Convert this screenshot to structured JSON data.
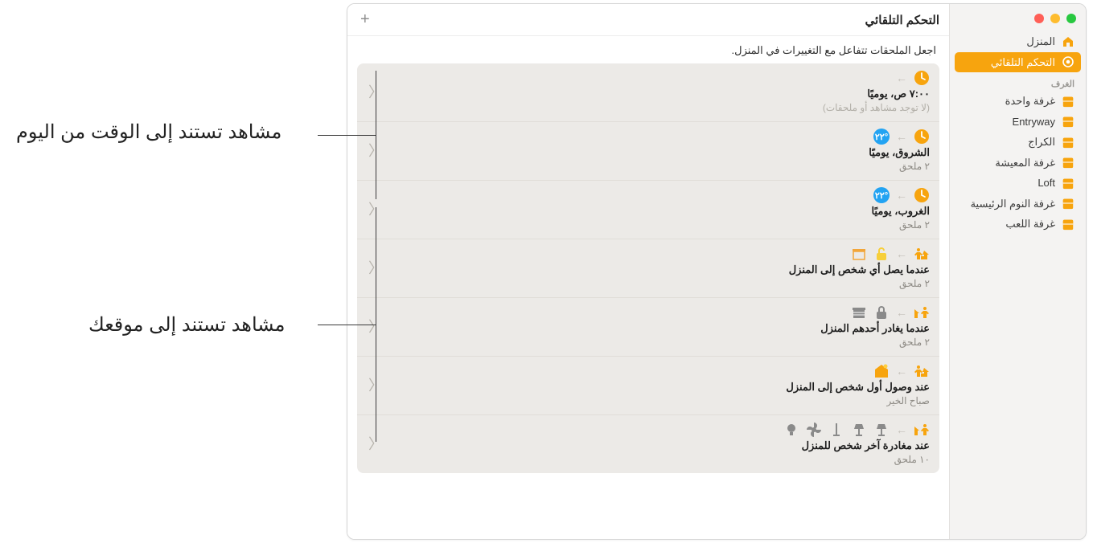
{
  "window": {
    "title": "التحكم التلقائي",
    "subtitle": "اجعل الملحقات تتفاعل مع التغييرات في المنزل."
  },
  "sidebar": {
    "home": "المنزل",
    "automation": "التحكم التلقائي",
    "rooms_header": "الغرف",
    "rooms": [
      "غرفة واحدة",
      "Entryway",
      "الكراج",
      "غرفة المعيشة",
      "Loft",
      "غرفة النوم الرئيسية",
      "غرفة اللعب"
    ]
  },
  "automations": [
    {
      "title": "٧:٠٠ ص، يوميًا",
      "meta": "(لا توجد مشاهد أو ملحقات)",
      "meta_muted": true,
      "icons": [
        "clock"
      ],
      "extra": [
        "arrow"
      ]
    },
    {
      "title": "الشروق، يوميًا",
      "meta": "٢ ملحق",
      "icons": [
        "clock"
      ],
      "extra": [
        "arrow",
        "blue"
      ]
    },
    {
      "title": "الغروب، يوميًا",
      "meta": "٢ ملحق",
      "icons": [
        "clock"
      ],
      "extra": [
        "arrow",
        "blue"
      ]
    },
    {
      "title": "عندما يصل أي شخص إلى المنزل",
      "meta": "٢ ملحق",
      "icons": [
        "person-arrive"
      ],
      "extra": [
        "arrow",
        "unlock",
        "garage-open"
      ]
    },
    {
      "title": "عندما يغادر أحدهم المنزل",
      "meta": "٢ ملحق",
      "icons": [
        "person-leave"
      ],
      "extra": [
        "arrow",
        "lock",
        "garage-closed"
      ]
    },
    {
      "title": "عند وصول أول شخص إلى المنزل",
      "meta": "صباح الخير",
      "icons": [
        "person-arrive"
      ],
      "extra": [
        "arrow",
        "scene-home"
      ]
    },
    {
      "title": "عند مغادرة آخر شخص للمنزل",
      "meta": "١٠ ملحق",
      "icons": [
        "person-leave"
      ],
      "extra": [
        "arrow",
        "lamp",
        "lamp",
        "stick",
        "fan",
        "bulb"
      ]
    }
  ],
  "callouts": {
    "time": "مشاهد تستند إلى الوقت من اليوم",
    "location": "مشاهد تستند إلى موقعك"
  }
}
